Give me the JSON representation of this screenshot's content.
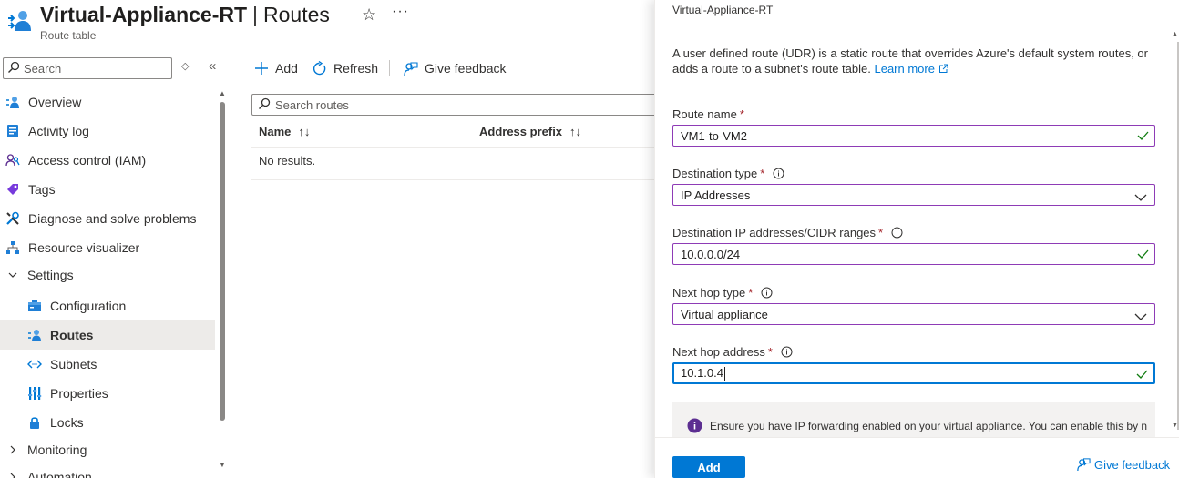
{
  "header": {
    "resource_name": "Virtual-Appliance-RT",
    "separator": "|",
    "page_name": "Routes",
    "subtitle": "Route table",
    "star_icon": "☆",
    "more_icon": "···"
  },
  "nav": {
    "search_placeholder": "Search",
    "updown_icon": "◇",
    "collapse_icon": "«",
    "items": [
      {
        "label": "Overview",
        "icon": "overview-icon"
      },
      {
        "label": "Activity log",
        "icon": "activity-log-icon"
      },
      {
        "label": "Access control (IAM)",
        "icon": "iam-icon"
      },
      {
        "label": "Tags",
        "icon": "tag-icon"
      },
      {
        "label": "Diagnose and solve problems",
        "icon": "wrench-icon"
      },
      {
        "label": "Resource visualizer",
        "icon": "visualizer-icon"
      },
      {
        "label": "Settings",
        "icon": "chevron-down-icon"
      },
      {
        "label": "Configuration",
        "icon": "configuration-icon"
      },
      {
        "label": "Routes",
        "icon": "routes-icon"
      },
      {
        "label": "Subnets",
        "icon": "subnets-icon"
      },
      {
        "label": "Properties",
        "icon": "properties-icon"
      },
      {
        "label": "Locks",
        "icon": "lock-icon"
      },
      {
        "label": "Monitoring",
        "icon": "chevron-right-icon"
      },
      {
        "label": "Automation",
        "icon": "chevron-right-icon"
      }
    ]
  },
  "toolbar": {
    "add_label": "Add",
    "refresh_label": "Refresh",
    "feedback_label": "Give feedback"
  },
  "routes": {
    "search_placeholder": "Search routes",
    "columns": [
      "Name",
      "Address prefix"
    ],
    "sort_icon": "↑↓",
    "empty_text": "No results."
  },
  "blade": {
    "breadcrumb": "Virtual-Appliance-RT",
    "description": "A user defined route (UDR) is a static route that overrides Azure's default system routes, or adds a route to a subnet's route table.",
    "learn_more": "Learn more",
    "required_mark": "*",
    "fields": {
      "route_name": {
        "label": "Route name",
        "value": "VM1-to-VM2"
      },
      "destination_type": {
        "label": "Destination type",
        "value": "IP Addresses"
      },
      "destination_ip": {
        "label": "Destination IP addresses/CIDR ranges",
        "value": "10.0.0.0/24"
      },
      "next_hop_type": {
        "label": "Next hop type",
        "value": "Virtual appliance"
      },
      "next_hop_address": {
        "label": "Next hop address",
        "value": "10.1.0.4"
      }
    },
    "info_text": "Ensure you have IP forwarding enabled on your virtual appliance. You can enable this by navigating to the respective network interface's IP address settings.",
    "add_button": "Add",
    "feedback_label": "Give feedback"
  },
  "colors": {
    "accent": "#0078d4",
    "valid_border": "#8e3bb6",
    "valid_check": "#107c10",
    "required": "#a4262c",
    "info": "#5c2e91"
  }
}
